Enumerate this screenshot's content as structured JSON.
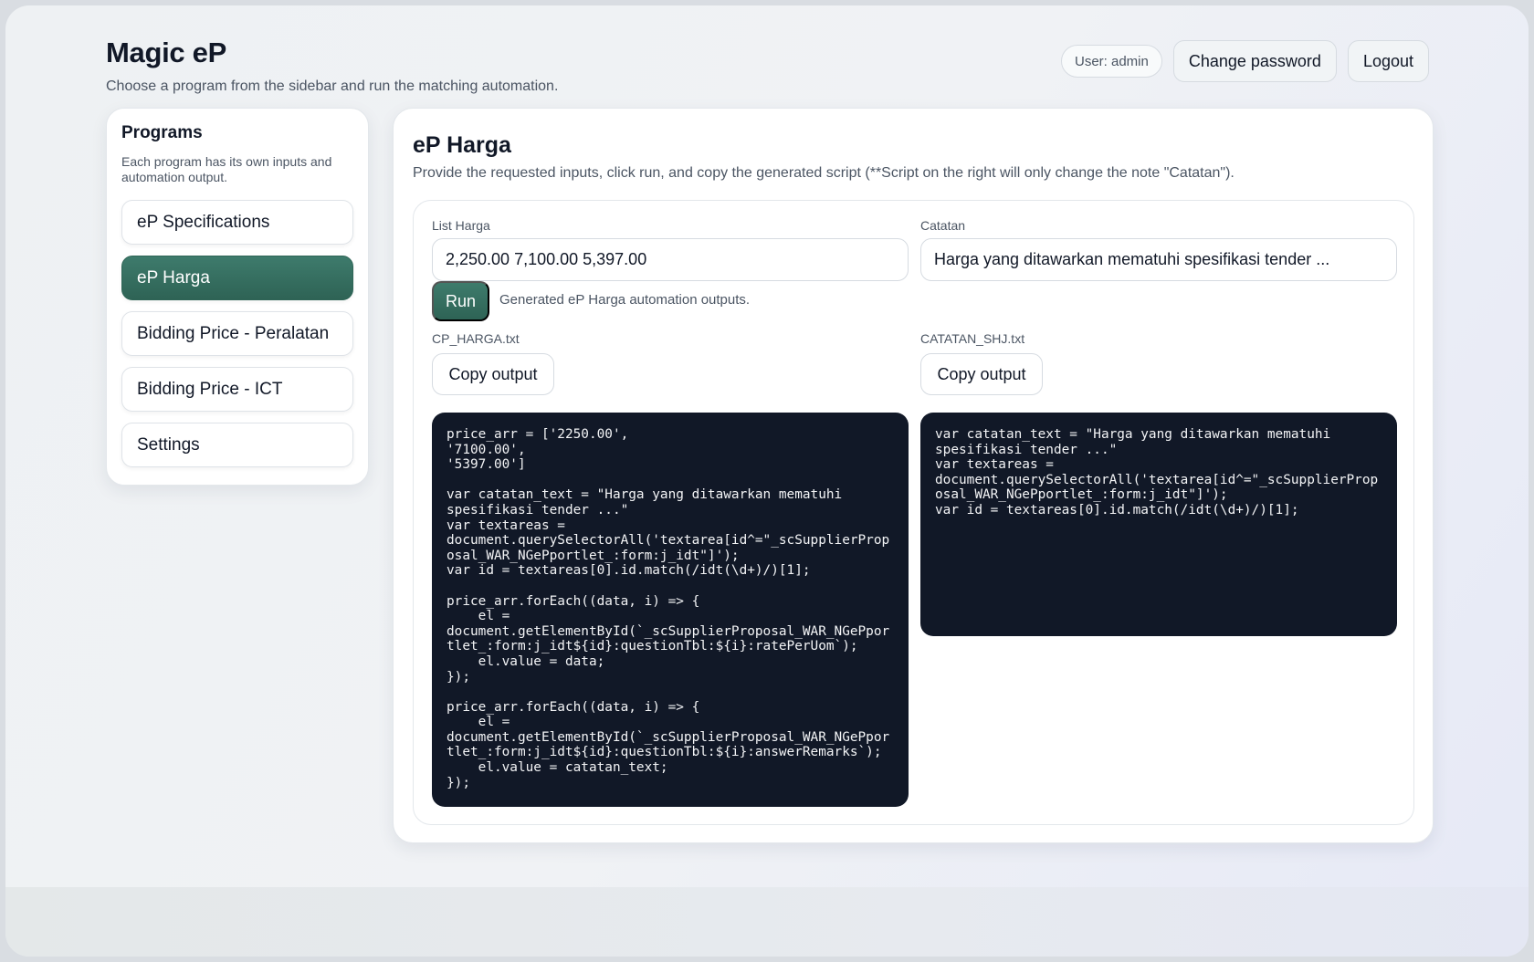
{
  "header": {
    "title": "Magic eP",
    "subtitle": "Choose a program from the sidebar and run the matching automation.",
    "user_label": "User: admin",
    "change_password_label": "Change password",
    "logout_label": "Logout"
  },
  "sidebar": {
    "title": "Programs",
    "description": "Each program has its own inputs and automation output.",
    "items": [
      {
        "label": "eP Specifications",
        "active": false
      },
      {
        "label": "eP Harga",
        "active": true
      },
      {
        "label": "Bidding Price - Peralatan",
        "active": false
      },
      {
        "label": "Bidding Price - ICT",
        "active": false
      },
      {
        "label": "Settings",
        "active": false
      }
    ]
  },
  "main": {
    "title": "eP Harga",
    "description": "Provide the requested inputs, click run, and copy the generated script (**Script on the right will only change the note \"Catatan\").",
    "list_harga_label": "List Harga",
    "list_harga_value": "2,250.00 7,100.00 5,397.00",
    "catatan_label": "Catatan",
    "catatan_value": "Harga yang ditawarkan mematuhi spesifikasi tender ...",
    "run_label": "Run",
    "run_status": "Generated eP Harga automation outputs.",
    "output_left_filename": "CP_HARGA.txt",
    "output_right_filename": "CATATAN_SHJ.txt",
    "copy_label": "Copy output",
    "output_left_code": "price_arr = ['2250.00',\n'7100.00',\n'5397.00']\n\nvar catatan_text = \"Harga yang ditawarkan mematuhi\nspesifikasi tender ...\"\nvar textareas =\ndocument.querySelectorAll('textarea[id^=\"_scSupplierProp\nosal_WAR_NGePportlet_:form:j_idt\"]');\nvar id = textareas[0].id.match(/idt(\\d+)/)[1];\n\nprice_arr.forEach((data, i) => {\n    el =\ndocument.getElementById(`_scSupplierProposal_WAR_NGePpor\ntlet_:form:j_idt${id}:questionTbl:${i}:ratePerUom`);\n    el.value = data;\n});\n\nprice_arr.forEach((data, i) => {\n    el =\ndocument.getElementById(`_scSupplierProposal_WAR_NGePpor\ntlet_:form:j_idt${id}:questionTbl:${i}:answerRemarks`);\n    el.value = catatan_text;\n});",
    "output_right_code": "var catatan_text = \"Harga yang ditawarkan mematuhi\nspesifikasi tender ...\"\nvar textareas =\ndocument.querySelectorAll('textarea[id^=\"_scSupplierProp\nosal_WAR_NGePportlet_:form:j_idt\"]');\nvar id = textareas[0].id.match(/idt(\\d+)/)[1];"
  },
  "colors": {
    "accent": "#2e6355",
    "code_bg": "#111827"
  }
}
